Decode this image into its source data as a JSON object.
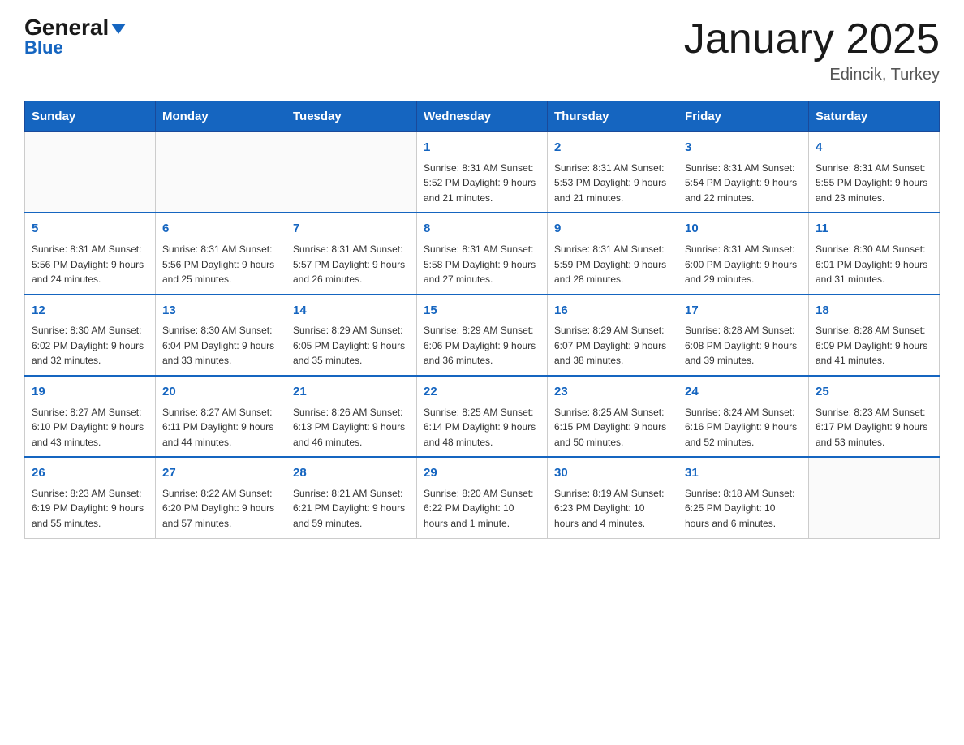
{
  "header": {
    "logo_general": "General",
    "logo_blue": "Blue",
    "month_title": "January 2025",
    "location": "Edincik, Turkey"
  },
  "calendar": {
    "days_of_week": [
      "Sunday",
      "Monday",
      "Tuesday",
      "Wednesday",
      "Thursday",
      "Friday",
      "Saturday"
    ],
    "weeks": [
      [
        {
          "day": "",
          "info": ""
        },
        {
          "day": "",
          "info": ""
        },
        {
          "day": "",
          "info": ""
        },
        {
          "day": "1",
          "info": "Sunrise: 8:31 AM\nSunset: 5:52 PM\nDaylight: 9 hours\nand 21 minutes."
        },
        {
          "day": "2",
          "info": "Sunrise: 8:31 AM\nSunset: 5:53 PM\nDaylight: 9 hours\nand 21 minutes."
        },
        {
          "day": "3",
          "info": "Sunrise: 8:31 AM\nSunset: 5:54 PM\nDaylight: 9 hours\nand 22 minutes."
        },
        {
          "day": "4",
          "info": "Sunrise: 8:31 AM\nSunset: 5:55 PM\nDaylight: 9 hours\nand 23 minutes."
        }
      ],
      [
        {
          "day": "5",
          "info": "Sunrise: 8:31 AM\nSunset: 5:56 PM\nDaylight: 9 hours\nand 24 minutes."
        },
        {
          "day": "6",
          "info": "Sunrise: 8:31 AM\nSunset: 5:56 PM\nDaylight: 9 hours\nand 25 minutes."
        },
        {
          "day": "7",
          "info": "Sunrise: 8:31 AM\nSunset: 5:57 PM\nDaylight: 9 hours\nand 26 minutes."
        },
        {
          "day": "8",
          "info": "Sunrise: 8:31 AM\nSunset: 5:58 PM\nDaylight: 9 hours\nand 27 minutes."
        },
        {
          "day": "9",
          "info": "Sunrise: 8:31 AM\nSunset: 5:59 PM\nDaylight: 9 hours\nand 28 minutes."
        },
        {
          "day": "10",
          "info": "Sunrise: 8:31 AM\nSunset: 6:00 PM\nDaylight: 9 hours\nand 29 minutes."
        },
        {
          "day": "11",
          "info": "Sunrise: 8:30 AM\nSunset: 6:01 PM\nDaylight: 9 hours\nand 31 minutes."
        }
      ],
      [
        {
          "day": "12",
          "info": "Sunrise: 8:30 AM\nSunset: 6:02 PM\nDaylight: 9 hours\nand 32 minutes."
        },
        {
          "day": "13",
          "info": "Sunrise: 8:30 AM\nSunset: 6:04 PM\nDaylight: 9 hours\nand 33 minutes."
        },
        {
          "day": "14",
          "info": "Sunrise: 8:29 AM\nSunset: 6:05 PM\nDaylight: 9 hours\nand 35 minutes."
        },
        {
          "day": "15",
          "info": "Sunrise: 8:29 AM\nSunset: 6:06 PM\nDaylight: 9 hours\nand 36 minutes."
        },
        {
          "day": "16",
          "info": "Sunrise: 8:29 AM\nSunset: 6:07 PM\nDaylight: 9 hours\nand 38 minutes."
        },
        {
          "day": "17",
          "info": "Sunrise: 8:28 AM\nSunset: 6:08 PM\nDaylight: 9 hours\nand 39 minutes."
        },
        {
          "day": "18",
          "info": "Sunrise: 8:28 AM\nSunset: 6:09 PM\nDaylight: 9 hours\nand 41 minutes."
        }
      ],
      [
        {
          "day": "19",
          "info": "Sunrise: 8:27 AM\nSunset: 6:10 PM\nDaylight: 9 hours\nand 43 minutes."
        },
        {
          "day": "20",
          "info": "Sunrise: 8:27 AM\nSunset: 6:11 PM\nDaylight: 9 hours\nand 44 minutes."
        },
        {
          "day": "21",
          "info": "Sunrise: 8:26 AM\nSunset: 6:13 PM\nDaylight: 9 hours\nand 46 minutes."
        },
        {
          "day": "22",
          "info": "Sunrise: 8:25 AM\nSunset: 6:14 PM\nDaylight: 9 hours\nand 48 minutes."
        },
        {
          "day": "23",
          "info": "Sunrise: 8:25 AM\nSunset: 6:15 PM\nDaylight: 9 hours\nand 50 minutes."
        },
        {
          "day": "24",
          "info": "Sunrise: 8:24 AM\nSunset: 6:16 PM\nDaylight: 9 hours\nand 52 minutes."
        },
        {
          "day": "25",
          "info": "Sunrise: 8:23 AM\nSunset: 6:17 PM\nDaylight: 9 hours\nand 53 minutes."
        }
      ],
      [
        {
          "day": "26",
          "info": "Sunrise: 8:23 AM\nSunset: 6:19 PM\nDaylight: 9 hours\nand 55 minutes."
        },
        {
          "day": "27",
          "info": "Sunrise: 8:22 AM\nSunset: 6:20 PM\nDaylight: 9 hours\nand 57 minutes."
        },
        {
          "day": "28",
          "info": "Sunrise: 8:21 AM\nSunset: 6:21 PM\nDaylight: 9 hours\nand 59 minutes."
        },
        {
          "day": "29",
          "info": "Sunrise: 8:20 AM\nSunset: 6:22 PM\nDaylight: 10 hours\nand 1 minute."
        },
        {
          "day": "30",
          "info": "Sunrise: 8:19 AM\nSunset: 6:23 PM\nDaylight: 10 hours\nand 4 minutes."
        },
        {
          "day": "31",
          "info": "Sunrise: 8:18 AM\nSunset: 6:25 PM\nDaylight: 10 hours\nand 6 minutes."
        },
        {
          "day": "",
          "info": ""
        }
      ]
    ]
  }
}
